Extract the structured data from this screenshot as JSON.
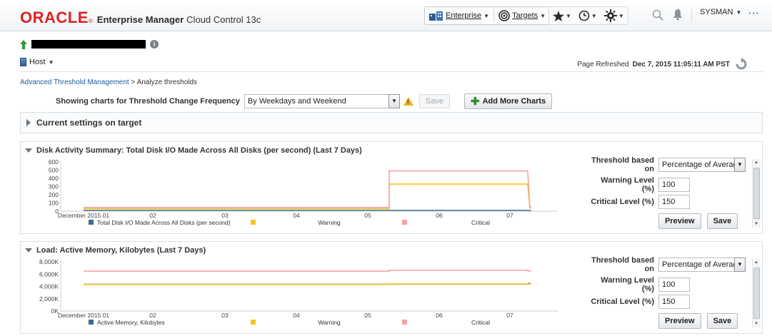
{
  "header": {
    "logo_brand": "ORACLE",
    "logo_product": "Enterprise Manager",
    "logo_edition": "Cloud Control 13c",
    "nav": {
      "enterprise": "Enterprise",
      "targets": "Targets",
      "user": "SYSMAN"
    }
  },
  "target": {
    "type_menu": "Host",
    "page_refreshed_label": "Page Refreshed",
    "page_refreshed_value": "Dec 7, 2015 11:05:11 AM PST"
  },
  "breadcrumb": {
    "parent": "Advanced Threshold Management",
    "separator": " > ",
    "current": "Analyze thresholds"
  },
  "toolbar": {
    "showing_label": "Showing charts for Threshold Change Frequency",
    "frequency_value": "By Weekdays and Weekend",
    "save_label": "Save",
    "add_more_label": "Add More Charts"
  },
  "current_settings": {
    "title": "Current settings on target"
  },
  "charts": [
    {
      "title": "Disk Activity Summary: Total Disk I/O Made Across All Disks (per second) (Last 7 Days)",
      "threshold_based_label": "Threshold based on",
      "threshold_based_value": "Percentage of Average",
      "warning_label": "Warning Level (%)",
      "warning_value": "100",
      "critical_label": "Critical Level (%)",
      "critical_value": "150",
      "preview_label": "Preview",
      "save_label": "Save"
    },
    {
      "title": "Load: Active Memory, Kilobytes (Last 7 Days)",
      "threshold_based_label": "Threshold based on",
      "threshold_based_value": "Percentage of Average",
      "warning_label": "Warning Level (%)",
      "warning_value": "100",
      "critical_label": "Critical Level (%)",
      "critical_value": "150",
      "preview_label": "Preview",
      "save_label": "Save"
    }
  ],
  "chart_data": [
    {
      "type": "line",
      "categories": [
        "December 2015 01",
        "02",
        "03",
        "04",
        "05",
        "06",
        "07"
      ],
      "yticks": [
        "600",
        "500",
        "400",
        "300",
        "200",
        "100",
        "0"
      ],
      "ylim": [
        0,
        600
      ],
      "xlim": [
        0,
        6.3
      ],
      "colors": {
        "data": "#3a6e8f",
        "warning": "#f7c41f",
        "critical": "#f4a4a4"
      },
      "series": [
        {
          "name": "Total Disk I/O Made Across All Disks (per second)",
          "x": [
            0,
            6.25,
            6.3
          ],
          "values": [
            10,
            10,
            5
          ]
        },
        {
          "name": "Warning",
          "x": [
            0,
            4.3,
            4.3,
            6.25,
            6.28,
            6.3
          ],
          "values": [
            30,
            30,
            330,
            330,
            40,
            30
          ]
        },
        {
          "name": "Critical",
          "x": [
            0,
            4.3,
            4.3,
            6.25,
            6.28,
            6.3
          ],
          "values": [
            45,
            45,
            490,
            490,
            60,
            45
          ]
        }
      ]
    },
    {
      "type": "line",
      "categories": [
        "December 2015 01",
        "02",
        "03",
        "04",
        "05",
        "06",
        "07"
      ],
      "yticks": [
        "8,000K",
        "6,000K",
        "4,000K",
        "2,000K",
        "0K"
      ],
      "ylim": [
        0,
        9000
      ],
      "xlim": [
        0,
        6.3
      ],
      "colors": {
        "data": "#3a6e8f",
        "warning": "#f7c41f",
        "critical": "#f4a4a4"
      },
      "series": [
        {
          "name": "Active Memory, Kilobytes",
          "x": [
            0,
            6.25,
            6.27,
            6.3
          ],
          "values": [
            4900,
            4900,
            5100,
            4900
          ]
        },
        {
          "name": "Warning",
          "x": [
            0,
            4.3,
            4.3,
            6.25,
            6.3
          ],
          "values": [
            4850,
            4850,
            4950,
            4950,
            4950
          ]
        },
        {
          "name": "Critical",
          "x": [
            0,
            4.3,
            4.3,
            6.25,
            6.25,
            6.3
          ],
          "values": [
            7300,
            7300,
            7450,
            7450,
            7350,
            7350
          ]
        }
      ]
    }
  ]
}
